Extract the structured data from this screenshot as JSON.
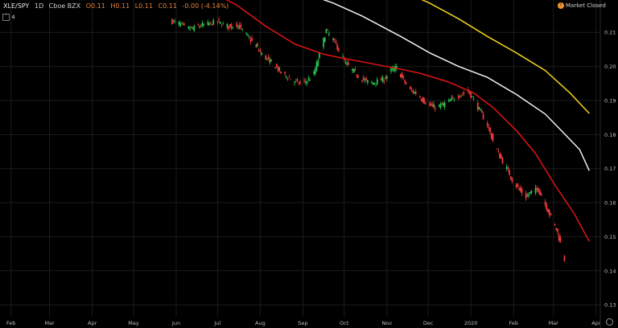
{
  "header": {
    "symbol": "XLE/SPY",
    "interval": "1D",
    "exchange": "Cboe BZX",
    "open": "O0.11",
    "high": "H0.11",
    "low": "L0.11",
    "close": "C0.11",
    "change": "-0.00 (-4.14%)"
  },
  "collapse_label": "4",
  "market_status": "Market Closed",
  "colors": {
    "background": "#000000",
    "up": "#26c050",
    "down": "#ef3a3a",
    "ma_short": "#e01414",
    "ma_mid": "#f2f2f2",
    "ma_long": "#f4d21c",
    "grid": "#1c1c1c",
    "axis_text": "#bdbdbd"
  },
  "chart_data": {
    "type": "candlestick",
    "x_axis": {
      "type": "date",
      "range": [
        "2019-01-24",
        "2020-04-04"
      ],
      "tick_labels": [
        {
          "date": "2019-02-01",
          "label": "Feb"
        },
        {
          "date": "2019-03-01",
          "label": "Mar"
        },
        {
          "date": "2019-04-01",
          "label": "Apr"
        },
        {
          "date": "2019-05-01",
          "label": "May"
        },
        {
          "date": "2019-06-01",
          "label": "Jun"
        },
        {
          "date": "2019-07-01",
          "label": "Jul"
        },
        {
          "date": "2019-08-01",
          "label": "Aug"
        },
        {
          "date": "2019-09-01",
          "label": "Sep"
        },
        {
          "date": "2019-10-01",
          "label": "Oct"
        },
        {
          "date": "2019-11-01",
          "label": "Nov"
        },
        {
          "date": "2019-12-01",
          "label": "Dec"
        },
        {
          "date": "2020-01-01",
          "label": "2020"
        },
        {
          "date": "2020-02-01",
          "label": "Feb"
        },
        {
          "date": "2020-03-01",
          "label": "Mar"
        },
        {
          "date": "2020-04-01",
          "label": "Apr"
        }
      ]
    },
    "y_axis": {
      "range": [
        0.1265,
        0.2195
      ],
      "ticks": [
        "0.21",
        "0.20",
        "0.19",
        "0.18",
        "0.17",
        "0.16",
        "0.15",
        "0.14",
        "0.13"
      ]
    },
    "grid": true,
    "series": [
      {
        "kind": "close",
        "points": [
          [
            "2019-05-29",
            0.2132
          ],
          [
            "2019-06-03",
            0.2126
          ],
          [
            "2019-06-07",
            0.2116
          ],
          [
            "2019-06-12",
            0.211
          ],
          [
            "2019-06-17",
            0.2118
          ],
          [
            "2019-06-21",
            0.2122
          ],
          [
            "2019-06-26",
            0.2126
          ],
          [
            "2019-07-01",
            0.2132
          ],
          [
            "2019-07-05",
            0.2122
          ],
          [
            "2019-07-10",
            0.2116
          ],
          [
            "2019-07-15",
            0.2124
          ],
          [
            "2019-07-19",
            0.2106
          ],
          [
            "2019-07-24",
            0.2082
          ],
          [
            "2019-07-29",
            0.206
          ],
          [
            "2019-08-02",
            0.2036
          ],
          [
            "2019-08-07",
            0.2018
          ],
          [
            "2019-08-12",
            0.2
          ],
          [
            "2019-08-16",
            0.1982
          ],
          [
            "2019-08-21",
            0.1968
          ],
          [
            "2019-08-26",
            0.1956
          ],
          [
            "2019-08-30",
            0.195
          ],
          [
            "2019-09-04",
            0.1958
          ],
          [
            "2019-09-09",
            0.1978
          ],
          [
            "2019-09-13",
            0.2034
          ],
          [
            "2019-09-18",
            0.2106
          ],
          [
            "2019-09-23",
            0.2078
          ],
          [
            "2019-09-27",
            0.205
          ],
          [
            "2019-10-02",
            0.2008
          ],
          [
            "2019-10-07",
            0.199
          ],
          [
            "2019-10-11",
            0.1972
          ],
          [
            "2019-10-16",
            0.1958
          ],
          [
            "2019-10-21",
            0.1952
          ],
          [
            "2019-10-25",
            0.1956
          ],
          [
            "2019-10-30",
            0.1962
          ],
          [
            "2019-11-04",
            0.1988
          ],
          [
            "2019-11-08",
            0.1996
          ],
          [
            "2019-11-13",
            0.196
          ],
          [
            "2019-11-18",
            0.193
          ],
          [
            "2019-11-22",
            0.1922
          ],
          [
            "2019-11-27",
            0.1902
          ],
          [
            "2019-12-02",
            0.1886
          ],
          [
            "2019-12-06",
            0.188
          ],
          [
            "2019-12-11",
            0.1886
          ],
          [
            "2019-12-16",
            0.1896
          ],
          [
            "2019-12-20",
            0.1908
          ],
          [
            "2019-12-25",
            0.1918
          ],
          [
            "2019-12-30",
            0.1928
          ],
          [
            "2020-01-03",
            0.1902
          ],
          [
            "2020-01-08",
            0.1866
          ],
          [
            "2020-01-13",
            0.1828
          ],
          [
            "2020-01-17",
            0.1782
          ],
          [
            "2020-01-22",
            0.1736
          ],
          [
            "2020-01-27",
            0.17
          ],
          [
            "2020-01-31",
            0.1668
          ],
          [
            "2020-02-05",
            0.1638
          ],
          [
            "2020-02-10",
            0.1616
          ],
          [
            "2020-02-14",
            0.1632
          ],
          [
            "2020-02-19",
            0.164
          ],
          [
            "2020-02-24",
            0.1596
          ],
          [
            "2020-02-28",
            0.1558
          ],
          [
            "2020-03-04",
            0.1512
          ],
          [
            "2020-03-09",
            0.1433
          ]
        ]
      },
      {
        "kind": "moving-average",
        "color": "ma_short",
        "points": [
          [
            "2019-06-26",
            0.222
          ],
          [
            "2019-07-15",
            0.218
          ],
          [
            "2019-08-05",
            0.2118
          ],
          [
            "2019-08-26",
            0.2066
          ],
          [
            "2019-09-16",
            0.2036
          ],
          [
            "2019-09-30",
            0.2024
          ],
          [
            "2019-10-21",
            0.2008
          ],
          [
            "2019-11-11",
            0.1992
          ],
          [
            "2019-11-25",
            0.198
          ],
          [
            "2019-12-16",
            0.1954
          ],
          [
            "2020-01-03",
            0.1922
          ],
          [
            "2020-01-17",
            0.188
          ],
          [
            "2020-02-03",
            0.1812
          ],
          [
            "2020-02-17",
            0.1744
          ],
          [
            "2020-03-02",
            0.1652
          ],
          [
            "2020-03-16",
            0.1568
          ],
          [
            "2020-03-27",
            0.1486
          ]
        ]
      },
      {
        "kind": "moving-average",
        "color": "ma_mid",
        "points": [
          [
            "2019-08-30",
            0.222
          ],
          [
            "2019-09-23",
            0.2186
          ],
          [
            "2019-10-14",
            0.2148
          ],
          [
            "2019-11-11",
            0.2088
          ],
          [
            "2019-12-02",
            0.204
          ],
          [
            "2019-12-23",
            0.2
          ],
          [
            "2020-01-13",
            0.1968
          ],
          [
            "2020-02-03",
            0.1918
          ],
          [
            "2020-02-24",
            0.186
          ],
          [
            "2020-03-09",
            0.1802
          ],
          [
            "2020-03-20",
            0.1756
          ],
          [
            "2020-03-27",
            0.1694
          ]
        ]
      },
      {
        "kind": "moving-average",
        "color": "ma_long",
        "points": [
          [
            "2019-11-13",
            0.222
          ],
          [
            "2019-12-02",
            0.2186
          ],
          [
            "2019-12-23",
            0.214
          ],
          [
            "2020-01-13",
            0.2088
          ],
          [
            "2020-02-03",
            0.204
          ],
          [
            "2020-02-24",
            0.1988
          ],
          [
            "2020-03-13",
            0.1922
          ],
          [
            "2020-03-27",
            0.1862
          ]
        ]
      }
    ]
  }
}
